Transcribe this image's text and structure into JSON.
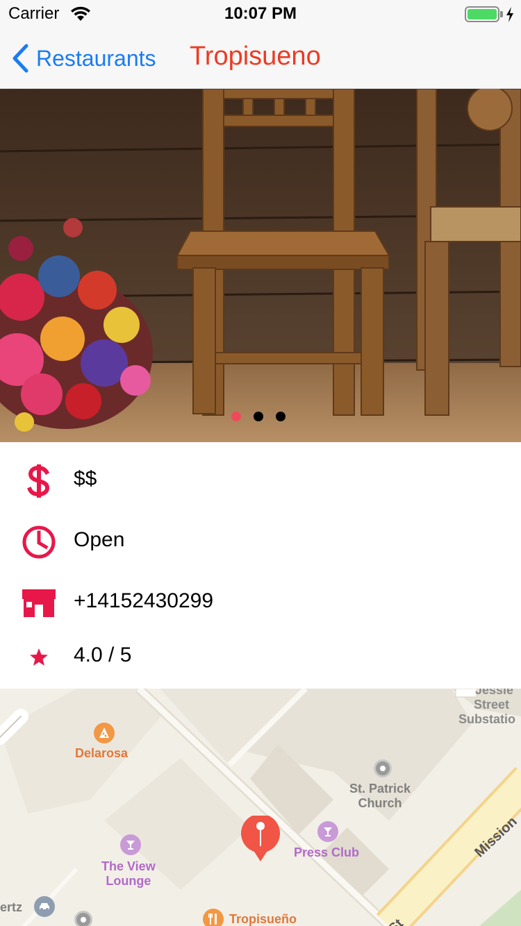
{
  "status_bar": {
    "carrier": "Carrier",
    "time": "10:07 PM",
    "battery_level": 1.0
  },
  "nav": {
    "back_label": "Restaurants",
    "title": "Tropisueno"
  },
  "gallery": {
    "page_count": 3,
    "current_page": 1
  },
  "info": {
    "price": "$$",
    "hours_status": "Open",
    "phone": "+14152430299",
    "rating": "4.0 / 5"
  },
  "map": {
    "labels": {
      "delarosa": "Delarosa",
      "st_patrick_1": "St. Patrick",
      "st_patrick_2": "Church",
      "press_club": "Press Club",
      "view_lounge_1": "The View",
      "view_lounge_2": "Lounge",
      "tropisueno": "Tropisueño",
      "jessie_1": "Jessie",
      "jessie_2": "Street",
      "jessie_3": "Substatio",
      "hertz": "ertz",
      "mission": "Mission",
      "street_fragment": "St"
    }
  },
  "colors": {
    "accent_red": "#ee3a23",
    "icon_red": "#e8174a",
    "ios_blue": "#1a7cf2",
    "page_dot_active": "#ef4a5a"
  }
}
